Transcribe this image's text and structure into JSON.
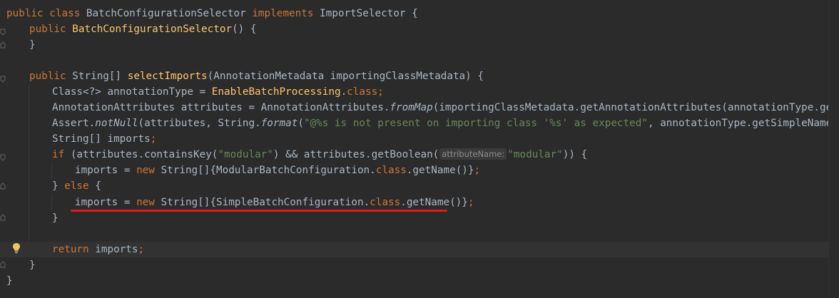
{
  "code": {
    "lines": [
      [
        "public ",
        "class ",
        "BatchConfigurationSelector ",
        "implements ",
        "ImportSelector {"
      ],
      [
        "public ",
        "BatchConfigurationSelector",
        "() {"
      ],
      [
        "}"
      ],
      [
        ""
      ],
      [
        "public ",
        "String[] ",
        "selectImports",
        "(AnnotationMetadata importingClassMetadata) {"
      ],
      [
        "Class<?> annotationType = ",
        "EnableBatchProcessing",
        ".",
        "class",
        ";"
      ],
      [
        "AnnotationAttributes attributes = AnnotationAttributes.",
        "fromMap",
        "(importingClassMetadata.getAnnotationAttributes(annotationType.getName(),"
      ],
      [
        "Assert.",
        "notNull",
        "(attributes, String.",
        "format",
        "(",
        "\"@%s is not present on importing class '%s' as expected\"",
        ", annotationType.getSimpleName(), import"
      ],
      [
        "String[] imports",
        ";"
      ],
      [
        "if ",
        "(attributes.containsKey(",
        "\"modular\"",
        ") && attributes.getBoolean(",
        "attributeName:",
        "\"modular\"",
        ")) {"
      ],
      [
        "imports = ",
        "new ",
        "String[]{ModularBatchConfiguration.",
        "class",
        ".getName()}",
        ";"
      ],
      [
        "} ",
        "else ",
        "{"
      ],
      [
        "imports = ",
        "new ",
        "String[]{SimpleBatchConfiguration.",
        "class",
        ".getName()}",
        ";"
      ],
      [
        "}"
      ],
      [
        ""
      ],
      [
        "return ",
        "imports",
        ";"
      ],
      [
        "}"
      ],
      [
        "}"
      ]
    ]
  },
  "colors": {
    "background": "#2b2b2b",
    "keyword": "#cc7832",
    "method": "#ffc66d",
    "string": "#6a8759",
    "text": "#a9b7c6",
    "underline": "#e01b1b"
  },
  "icons": {
    "intention": "lightbulb-icon",
    "fold": "fold-marker-icon"
  }
}
